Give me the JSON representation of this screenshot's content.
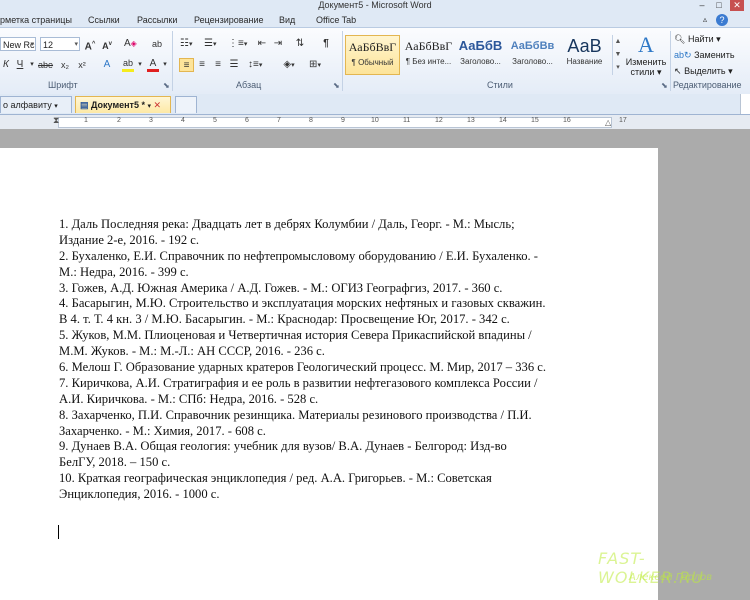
{
  "window": {
    "title": "Документ5 - Microsoft Word",
    "min": "–",
    "max": "□",
    "close": "✕"
  },
  "ribbon_tabs": [
    "рметка страницы",
    "Ссылки",
    "Рассылки",
    "Рецензирование",
    "Вид",
    "Office Tab"
  ],
  "font": {
    "name": "New Rc",
    "size": "12",
    "grow": "A",
    "shrink": "A",
    "clear": "A",
    "phonetic": "ab",
    "italic": "К",
    "underline": "Ч",
    "strike": "abe",
    "subscript": "x₂",
    "superscript": "x²",
    "effects": "A",
    "highlight": "ab",
    "color": "A",
    "group_label": "Шрифт"
  },
  "paragraph": {
    "group_label": "Абзац",
    "pilcrow": "¶"
  },
  "styles": {
    "group_label": "Стили",
    "items": [
      {
        "sample": "АаБбВвГ",
        "name": "¶ Обычный",
        "selected": true
      },
      {
        "sample": "АаБбВвГ",
        "name": "¶ Без инте...",
        "selected": false
      },
      {
        "sample": "АаБбВ",
        "name": "Заголово...",
        "selected": false
      },
      {
        "sample": "АаБбВв",
        "name": "Заголово...",
        "selected": false
      },
      {
        "sample": "АаВ",
        "name": "Название",
        "selected": false
      }
    ],
    "change": "Изменить",
    "change2": "стили"
  },
  "editing": {
    "find": "Найти",
    "replace": "Заменить",
    "select": "Выделить",
    "group_label": "Редактирование"
  },
  "doc_tabs": {
    "left": "о алфавиту",
    "active": "Документ5 *"
  },
  "ruler": {
    "labels": [
      "1",
      "2",
      "3",
      "4",
      "5",
      "6",
      "7",
      "8",
      "9",
      "10",
      "11",
      "12",
      "13",
      "14",
      "15",
      "16",
      "17"
    ]
  },
  "document": {
    "lines": [
      "1. Даль Последняя река: Двадцать лет в дебрях Колумбии / Даль, Георг. - М.: Мысль;",
      "Издание 2-е, 2016. - 192 с.",
      "2. Бухаленко, Е.И. Справочник по нефтепромысловому оборудованию / Е.И. Бухаленко. -",
      "М.: Недра, 2016. - 399 с.",
      "3. Гожев, А.Д. Южная Америка / А.Д. Гожев. - М.: ОГИЗ Географгиз, 2017. - 360 с.",
      "4. Басарыгин, М.Ю. Строительство и эксплуатация морских нефтяных и газовых скважин.",
      "В 4. т. Т. 4 кн. 3 / М.Ю. Басарыгин. - М.: Краснодар: Просвещение Юг, 2017. - 342 с.",
      "5. Жуков, М.М. Плиоценовая и Четвертичная история Севера Прикаспийской впадины /",
      "М.М. Жуков. - М.: М.-Л.: АН СССР, 2016. - 236 с.",
      "6. Мелош Г. Образование ударных кратеров Геологический процесс. М. Мир, 2017 – 336 с.",
      "7. Киричкова, А.И. Стратиграфия и ее роль в развитии нефтегазового комплекса России /",
      "А.И. Киричкова. - М.: СПб: Недра, 2016. - 528 с.",
      "8. Захарченко, П.И. Справочник резинщика. Материалы резинового производства / П.И.",
      "Захарченко. - М.: Химия, 2017. - 608 с.",
      "9. Дунаев В.А. Общая геология: учебник для вузов/ В.А. Дунаев - Белгород: Изд-во",
      "БелГУ, 2018. – 150 с.",
      "10. Краткая географическая энциклопедия  / ред. А.А. Григорьев. - М.: Советская",
      "Энциклопедия, 2016. - 1000 с."
    ]
  },
  "watermark": {
    "site": "FAST-WOLKER.RU",
    "author": "Алексей Горлов"
  },
  "colors": {
    "accent": "#2b579a",
    "selected_style": "#fde49a",
    "font_color_bar": "#e02020",
    "highlight_bar": "#f5ec1e"
  }
}
